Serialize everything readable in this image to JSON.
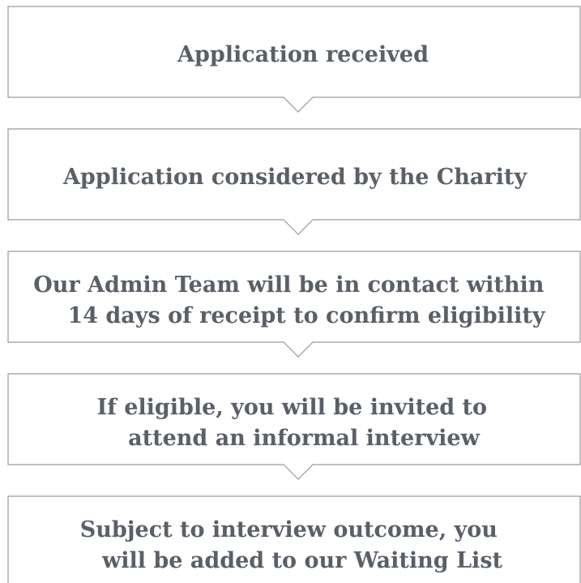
{
  "flowchart": {
    "steps": [
      {
        "lines": [
          "Application  received"
        ]
      },
      {
        "lines": [
          "Application  considered by the  Charity"
        ]
      },
      {
        "lines": [
          "Our Admin Team will be in contact within",
          "14 days of receipt to confirm eligibility"
        ]
      },
      {
        "lines": [
          "If eligible, you will be invited to",
          "attend an informal interview"
        ]
      },
      {
        "lines": [
          "Subject to interview outcome, you",
          "will be added to our Waiting List"
        ]
      }
    ]
  },
  "colors": {
    "text": "#5a6068",
    "border": "#9a9a9a",
    "background": "#ffffff"
  }
}
